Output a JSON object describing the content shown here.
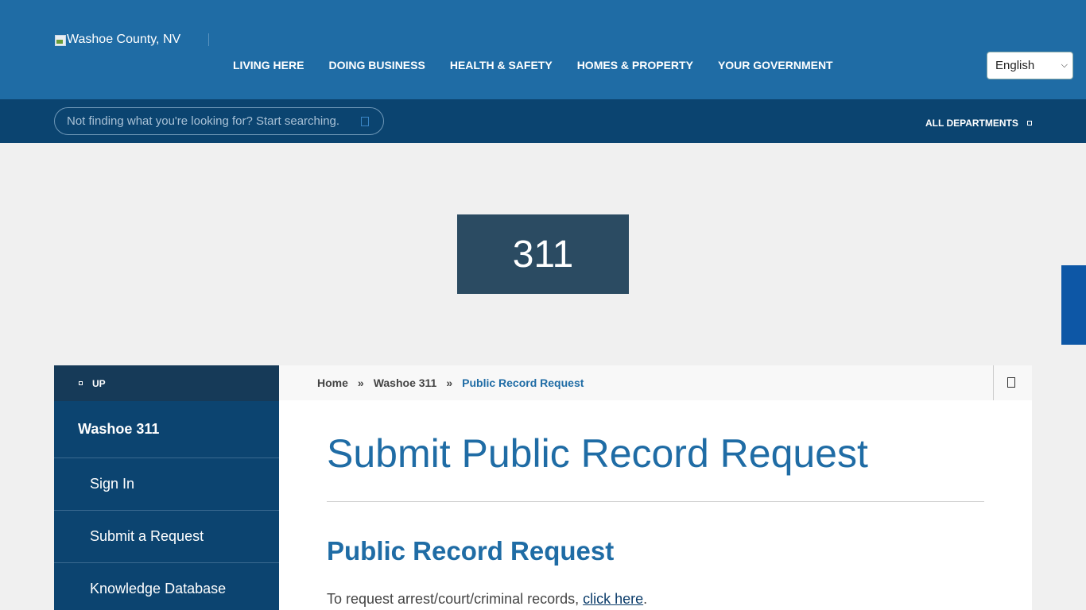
{
  "header": {
    "logo_alt": "Washoe County, NV",
    "nav": [
      "LIVING HERE",
      "DOING BUSINESS",
      "HEALTH & SAFETY",
      "HOMES & PROPERTY",
      "YOUR GOVERNMENT"
    ],
    "language": "English"
  },
  "search": {
    "placeholder": "Not finding what you're looking for? Start searching.",
    "all_departments": "ALL DEPARTMENTS"
  },
  "hero": {
    "title": "311"
  },
  "sidebar": {
    "up_label": "UP",
    "title": "Washoe 311",
    "items": [
      "Sign In",
      "Submit a Request",
      "Knowledge Database"
    ]
  },
  "breadcrumb": {
    "home": "Home",
    "sep": "»",
    "parent": "Washoe 311",
    "current": "Public Record Request"
  },
  "main": {
    "title": "Submit Public Record Request",
    "subtitle": "Public Record Request",
    "body_prefix": "To request arrest/court/criminal records, ",
    "body_link": "click here",
    "body_suffix": "."
  },
  "colors": {
    "header_blue": "#1f6ca5",
    "search_bar": "#0b4470",
    "hero_box": "#2b4b62",
    "sidebar": "#0c4470",
    "accent_link": "#1f6ca5"
  }
}
